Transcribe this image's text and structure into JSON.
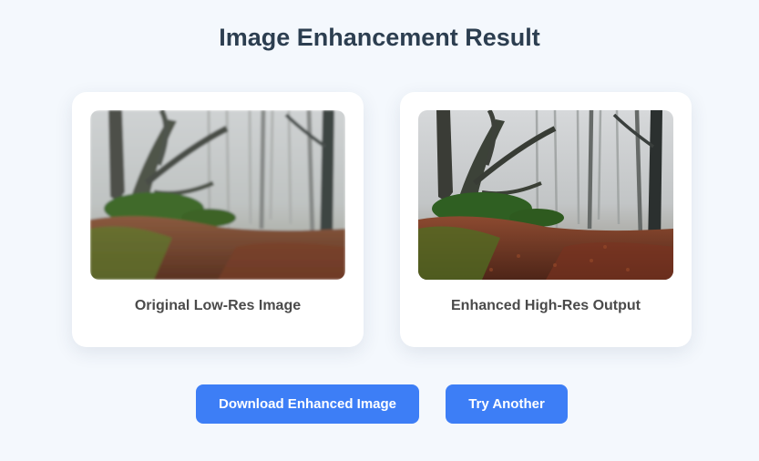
{
  "page": {
    "title": "Image Enhancement Result"
  },
  "cards": [
    {
      "caption": "Original Low-Res Image",
      "image": "misty-forest-photo-low-res"
    },
    {
      "caption": "Enhanced High-Res Output",
      "image": "misty-forest-photo-enhanced"
    }
  ],
  "actions": {
    "download_label": "Download Enhanced Image",
    "try_again_label": "Try Another"
  },
  "colors": {
    "background": "#f4f8fd",
    "title": "#2c3e50",
    "caption": "#4a4a4a",
    "button": "#3d7ef6",
    "button_text": "#ffffff"
  }
}
